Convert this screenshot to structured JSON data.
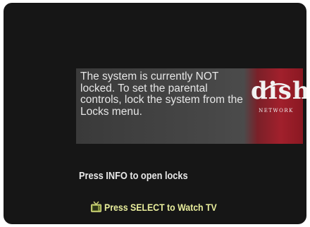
{
  "dialog": {
    "message": "The system is currently NOT locked. To set the parental controls, lock the system from the Locks menu."
  },
  "logo": {
    "wordmark": "dish",
    "subtitle": "NETWORK",
    "icon": "dish-network-logo"
  },
  "hints": {
    "info": "Press INFO to open locks",
    "select": "Press SELECT to Watch TV",
    "select_icon": "tv-icon",
    "select_color": "#e9ee9c"
  },
  "colors": {
    "background": "#161616",
    "panel": "#474747",
    "brand_red": "#a1202c",
    "text": "#e6e6e6"
  }
}
